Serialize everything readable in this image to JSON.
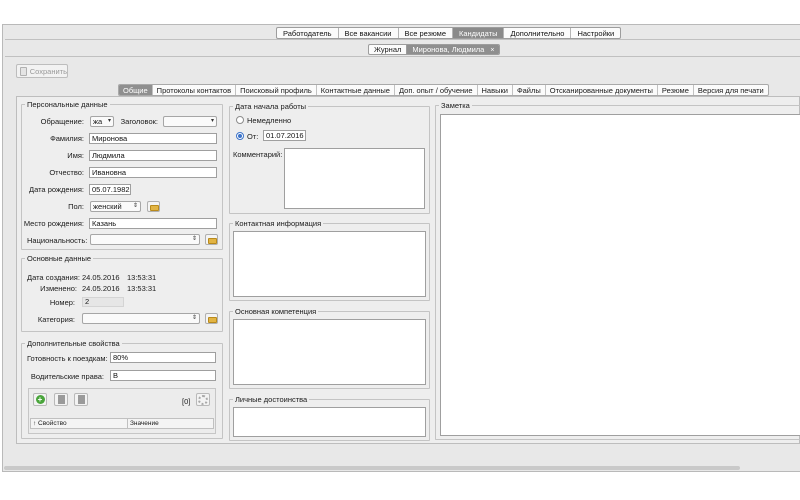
{
  "top_nav": {
    "tabs": [
      {
        "label": "Работодатель",
        "active": false
      },
      {
        "label": "Все вакансии",
        "active": false
      },
      {
        "label": "Все резюме",
        "active": false
      },
      {
        "label": "Кандидаты",
        "active": true
      },
      {
        "label": "Дополнительно",
        "active": false
      },
      {
        "label": "Настройки",
        "active": false
      }
    ]
  },
  "doc_tabs": {
    "tabs": [
      {
        "label": "Журнал",
        "active": false
      },
      {
        "label": "Миронова, Людмила",
        "active": true,
        "close": "×"
      }
    ]
  },
  "toolbar": {
    "save_label": "Сохранить"
  },
  "sub_tabs": [
    {
      "label": "Общие",
      "active": true
    },
    {
      "label": "Протоколы контактов"
    },
    {
      "label": "Поисковый профиль"
    },
    {
      "label": "Контактные данные"
    },
    {
      "label": "Доп. опыт / обучение"
    },
    {
      "label": "Навыки"
    },
    {
      "label": "Файлы"
    },
    {
      "label": "Отсканированные документы"
    },
    {
      "label": "Резюме"
    },
    {
      "label": "Версия для печати"
    }
  ],
  "personal": {
    "legend": "Персональные данные",
    "salutation_label": "Обращение:",
    "salutation_value": "жа",
    "header_label": "Заголовок:",
    "header_value": "",
    "lastname_label": "Фамилия:",
    "lastname_value": "Миронова",
    "firstname_label": "Имя:",
    "firstname_value": "Людмила",
    "patronymic_label": "Отчество:",
    "patronymic_value": "Ивановна",
    "birthdate_label": "Дата рождения:",
    "birthdate_value": "05.07.1982",
    "gender_label": "Пол:",
    "gender_value": "женский",
    "birthplace_label": "Место рождения:",
    "birthplace_value": "Казань",
    "nationality_label": "Национальность:",
    "nationality_value": ""
  },
  "basic": {
    "legend": "Основные данные",
    "created_label": "Дата создания:",
    "created_date": "24.05.2016",
    "created_time": "13:53:31",
    "changed_label": "Изменено:",
    "changed_date": "24.05.2016",
    "changed_time": "13:53:31",
    "number_label": "Номер:",
    "number_value": "2",
    "category_label": "Категория:",
    "category_value": ""
  },
  "extra": {
    "legend": "Дополнительные свойства",
    "travel_label": "Готовность к поездкам:",
    "travel_value": "80%",
    "license_label": "Водительские права:",
    "license_value": "В",
    "count": "[0]",
    "col_property": "↑ Свойство",
    "col_value": "Значение"
  },
  "start": {
    "legend": "Дата начала работы",
    "immediately_label": "Немедленно",
    "from_label": "От:",
    "from_value": "01.07.2016",
    "comment_label": "Комментарий:"
  },
  "contact_info": {
    "legend": "Контактная информация"
  },
  "competence": {
    "legend": "Основная компетенция"
  },
  "merits": {
    "legend": "Личные достоинства"
  },
  "note": {
    "legend": "Заметка"
  }
}
